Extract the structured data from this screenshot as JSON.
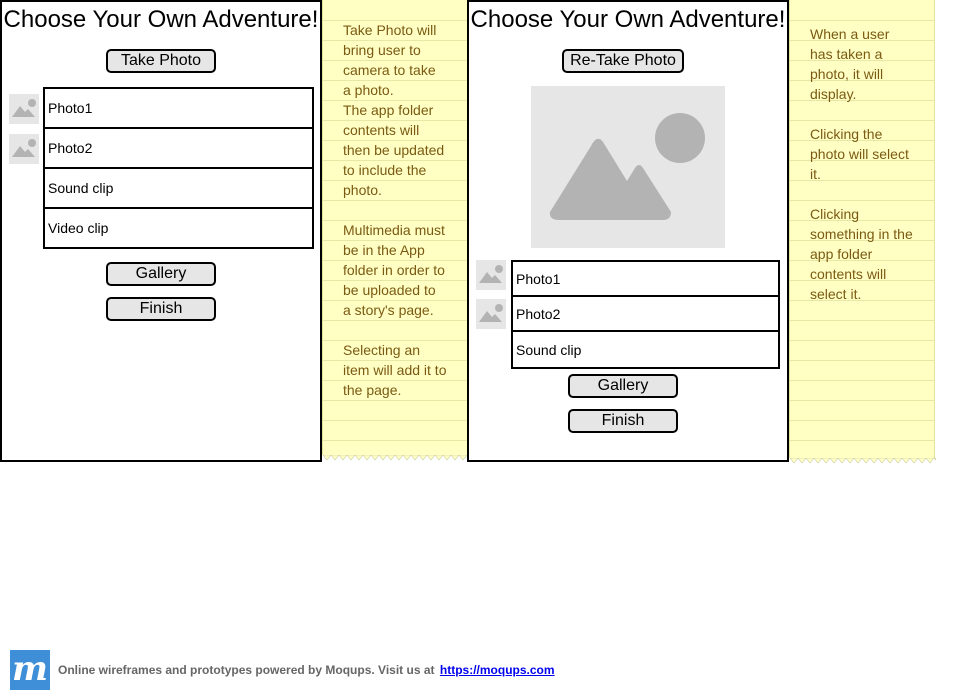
{
  "screen1": {
    "title": "Choose Your Own Adventure!",
    "take_photo_label": "Take Photo",
    "list": [
      "Photo1",
      "Photo2",
      "Sound clip",
      "Video clip"
    ],
    "gallery_label": "Gallery",
    "finish_label": "Finish"
  },
  "note1": {
    "text": "Take Photo will\nbring user to\ncamera to take\na photo.\nThe app folder\ncontents will\nthen be updated\nto include the\nphoto.\n\nMultimedia must\nbe in the App\nfolder in order to\nbe uploaded to\na story's page.\n\nSelecting an\nitem will add it to\nthe page."
  },
  "screen2": {
    "title": "Choose Your Own Adventure!",
    "retake_photo_label": "Re-Take Photo",
    "list": [
      "Photo1",
      "Photo2",
      "Sound clip"
    ],
    "gallery_label": "Gallery",
    "finish_label": "Finish"
  },
  "note2": {
    "text": "When a user\nhas taken a\nphoto, it will\ndisplay.\n\nClicking the\nphoto will select\nit.\n\nClicking\nsomething in the\napp folder\ncontents will\nselect it."
  },
  "footer": {
    "logo_letter": "m",
    "text": "Online wireframes and prototypes powered by Moqups. Visit us at",
    "link": "https://moqups.com"
  },
  "colors": {
    "note_background": "#ffffc4",
    "note_text": "#7a5a12",
    "button_fill": "#e6e6e6",
    "placeholder_fill": "#e6e6e6",
    "placeholder_shape": "#b3b3b3",
    "logo_blue": "#3e8fd8",
    "link_blue": "#0000ee"
  }
}
